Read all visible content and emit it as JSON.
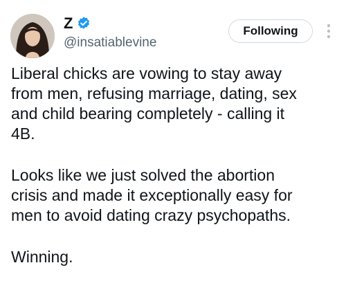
{
  "author": {
    "display_name": "Z",
    "handle": "@insatiablevine",
    "verified": true,
    "verified_icon": "verified-badge-icon",
    "avatar_icon": "profile-avatar"
  },
  "actions": {
    "follow_label": "Following",
    "more_icon": "more-vertical-icon"
  },
  "tweet": {
    "paragraphs": [
      [
        "Liberal chicks are vowing to stay away",
        "from men, refusing marriage, dating, sex",
        "and child bearing completely - calling it",
        "4B."
      ],
      [
        "Looks like we just solved the abortion",
        "crisis and made it exceptionally easy for",
        "men to avoid dating crazy psychopaths."
      ],
      [
        "Winning."
      ]
    ]
  },
  "colors": {
    "text": "#0f1419",
    "secondary": "#536471",
    "verified_blue": "#1d9bf0",
    "button_border": "#cfd9de"
  }
}
